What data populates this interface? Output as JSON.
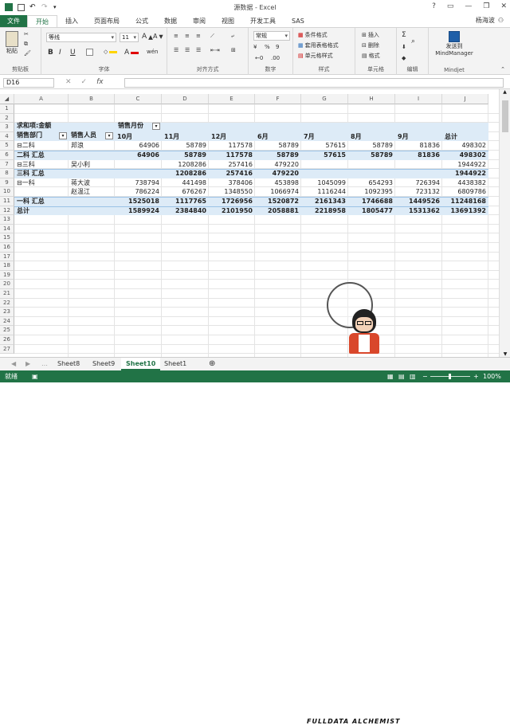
{
  "window": {
    "title": "源数据 - Excel",
    "help": "?",
    "minimize": "—",
    "restore": "❐",
    "close": "✕"
  },
  "tabs": [
    "文件",
    "开始",
    "插入",
    "页面布局",
    "公式",
    "数据",
    "审阅",
    "视图",
    "开发工具",
    "SAS"
  ],
  "user": "杨海波",
  "ribbon": {
    "clipboard": {
      "label": "剪贴板",
      "paste": "粘贴"
    },
    "font": {
      "label": "字体",
      "name": "等线",
      "size": "11",
      "bold": "B",
      "italic": "I",
      "underline": "U",
      "fill_color": "#ffd400",
      "font_color": "#e00000"
    },
    "alignment": {
      "label": "对齐方式"
    },
    "number": {
      "label": "数字",
      "format": "常规",
      "percent": "%",
      "comma": "9"
    },
    "styles": {
      "label": "样式",
      "conditional": "条件格式",
      "table": "套用表格格式",
      "cell": "单元格样式"
    },
    "cells": {
      "label": "单元格",
      "insert": "插入",
      "delete": "删除",
      "format": "格式"
    },
    "editing": {
      "label": "编辑"
    },
    "mindjet": {
      "label": "Mindjet",
      "send": "发送到",
      "app": "MindManager"
    }
  },
  "formula": {
    "namebox": "D16",
    "cancel": "✕",
    "enter": "✓",
    "fx": "fx",
    "value": ""
  },
  "columns": [
    "A",
    "B",
    "C",
    "D",
    "E",
    "F",
    "G",
    "H",
    "I",
    "J"
  ],
  "rows": [
    "1",
    "2",
    "3",
    "4",
    "5",
    "6",
    "7",
    "8",
    "9",
    "10",
    "11",
    "12",
    "13",
    "14",
    "15",
    "16",
    "17",
    "18",
    "19",
    "20",
    "21",
    "22",
    "23",
    "24",
    "25",
    "26",
    "27"
  ],
  "pivot": {
    "value_label": "求和项:金额",
    "col_field": "销售月份",
    "row_field1": "销售部门",
    "row_field2": "销售人员",
    "months": [
      "10月",
      "11月",
      "12月",
      "6月",
      "7月",
      "8月",
      "9月",
      "总计"
    ],
    "r5": {
      "a": "⊟二科",
      "b": "邦浪",
      "v": [
        "64906",
        "58789",
        "117578",
        "58789",
        "57615",
        "58789",
        "81836",
        "498302"
      ]
    },
    "r6": {
      "a": "二科 汇总",
      "v": [
        "64906",
        "58789",
        "117578",
        "58789",
        "57615",
        "58789",
        "81836",
        "498302"
      ]
    },
    "r7": {
      "a": "⊟三科",
      "b": "吴小利",
      "v": [
        "",
        "1208286",
        "257416",
        "479220",
        "",
        "",
        "",
        "1944922"
      ]
    },
    "r8": {
      "a": "三科 汇总",
      "v": [
        "",
        "1208286",
        "257416",
        "479220",
        "",
        "",
        "",
        "1944922"
      ]
    },
    "r9": {
      "a": "⊟一科",
      "b": "蒋大波",
      "v": [
        "738794",
        "441498",
        "378406",
        "453898",
        "1045099",
        "654293",
        "726394",
        "4438382"
      ]
    },
    "r10": {
      "b": "赵温江",
      "v": [
        "786224",
        "676267",
        "1348550",
        "1066974",
        "1116244",
        "1092395",
        "723132",
        "6809786"
      ]
    },
    "r11": {
      "a": "一科 汇总",
      "v": [
        "1525018",
        "1117765",
        "1726956",
        "1520872",
        "2161343",
        "1746688",
        "1449526",
        "11248168"
      ]
    },
    "r12": {
      "a": "总计",
      "v": [
        "1589924",
        "2384840",
        "2101950",
        "2058881",
        "2218958",
        "1805477",
        "1531362",
        "13691392"
      ]
    }
  },
  "sheet_tabs": [
    "Sheet8",
    "Sheet9",
    "Sheet10",
    "Sheet1"
  ],
  "active_sheet": "Sheet10",
  "status": {
    "ready": "就绪",
    "zoom": "100%"
  },
  "watermark": "FULLDATA ALCHEMIST",
  "accent": "#217346"
}
